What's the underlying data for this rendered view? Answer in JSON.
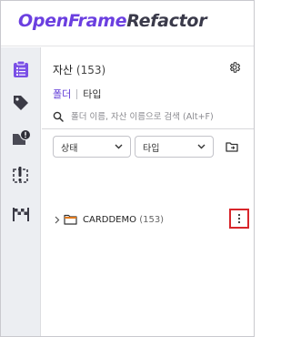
{
  "brand": {
    "part1": "OpenFrame",
    "part2": "Refactor"
  },
  "sidebar": {
    "items": [
      {
        "icon": "clipboard-list-icon",
        "active": true
      },
      {
        "icon": "tag-icon",
        "active": false
      },
      {
        "icon": "folder-alert-icon",
        "active": false
      },
      {
        "icon": "dashed-box-alert-icon",
        "active": false
      },
      {
        "icon": "checkered-flag-icon",
        "active": false
      }
    ]
  },
  "panel": {
    "title": "자산",
    "count": "(153)",
    "settings_icon": "gear-icon"
  },
  "tabs": {
    "folder": "폴더",
    "type": "타입"
  },
  "search": {
    "placeholder": "폴더 이름, 자산 이름으로 검색 (Alt+F)",
    "value": ""
  },
  "filters": {
    "status": "상태",
    "type": "타입",
    "add_folder_icon": "folder-add-icon"
  },
  "tree": [
    {
      "label": "CARDDEMO",
      "count": "(153)",
      "expanded": false
    }
  ],
  "colors": {
    "accent": "#5b34d6",
    "brand_purple": "#6b3fe0",
    "highlight": "#d8262b",
    "folder_orange": "#e07a1f"
  }
}
